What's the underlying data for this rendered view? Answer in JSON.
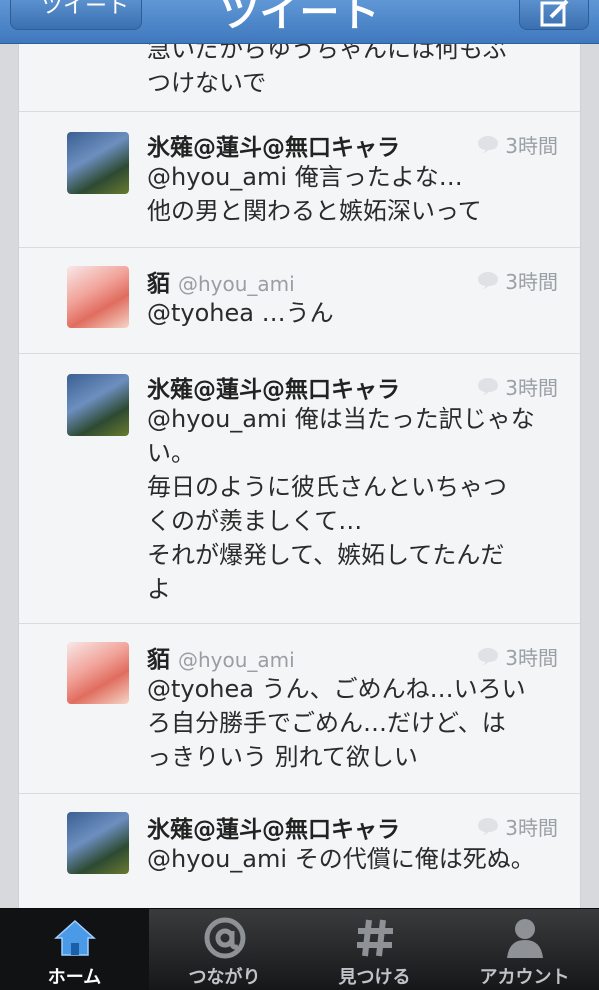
{
  "nav": {
    "back_label": "ツイート",
    "title": "ツイート",
    "compose_icon": "compose-icon"
  },
  "tweets": [
    {
      "name": "",
      "handle": "",
      "time": "",
      "body": "急いだからゆうちゃんには何もぶ\nつけないで"
    },
    {
      "name": "氷薙@蓮斗@無口キャラ",
      "handle": "",
      "time": "3時間",
      "body": "@hyou_ami 俺言ったよな…\n他の男と関わると嫉妬深いって"
    },
    {
      "name": "貊",
      "handle": "@hyou_ami",
      "time": "3時間",
      "body": "@tyohea …うん"
    },
    {
      "name": "氷薙@蓮斗@無口キャラ",
      "handle": "",
      "time": "3時間",
      "body": "@hyou_ami 俺は当たった訳じゃな\nい。\n毎日のように彼氏さんといちゃつ\nくのが羨ましくて…\nそれが爆発して、嫉妬してたんだ\nよ"
    },
    {
      "name": "貊",
      "handle": "@hyou_ami",
      "time": "3時間",
      "body": "@tyohea うん、ごめんね…いろい\nろ自分勝手でごめん…だけど、は\nっきりいう  別れて欲しい"
    },
    {
      "name": "氷薙@蓮斗@無口キャラ",
      "handle": "",
      "time": "3時間",
      "body": "@hyou_ami その代償に俺は死ぬ。"
    }
  ],
  "tabs": [
    {
      "label": "ホーム",
      "icon": "home-icon",
      "active": true
    },
    {
      "label": "つながり",
      "icon": "at-icon",
      "active": false
    },
    {
      "label": "見つける",
      "icon": "hash-icon",
      "active": false
    },
    {
      "label": "アカウント",
      "icon": "person-icon",
      "active": false
    }
  ],
  "colors": {
    "nav_blue": "#4a86cc",
    "tab_active_blue": "#3f8fe0",
    "timeline_bg": "#f4f5f6"
  }
}
